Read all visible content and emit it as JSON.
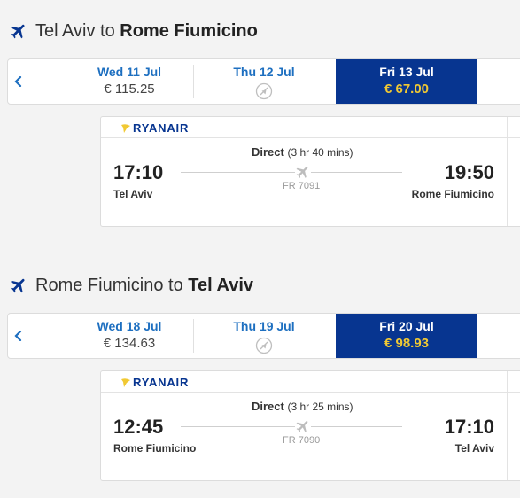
{
  "outbound": {
    "title_from": "Tel Aviv",
    "title_to_word": "to",
    "title_to": "Rome Fiumicino",
    "dates": [
      {
        "label": "Wed 11 Jul",
        "price": "€ 115.25",
        "selected": false,
        "available": true
      },
      {
        "label": "Thu 12 Jul",
        "price": "",
        "selected": false,
        "available": false
      },
      {
        "label": "Fri 13 Jul",
        "price": "€ 67.00",
        "selected": true,
        "available": true
      }
    ],
    "flight": {
      "airline": "RYANAIR",
      "type": "Direct",
      "duration": "(3 hr 40 mins)",
      "dep_time": "17:10",
      "arr_time": "19:50",
      "dep_city": "Tel Aviv",
      "arr_city": "Rome Fiumicino",
      "flight_number": "FR 7091"
    }
  },
  "inbound": {
    "title_from": "Rome Fiumicino",
    "title_to_word": "to",
    "title_to": "Tel Aviv",
    "dates": [
      {
        "label": "Wed 18 Jul",
        "price": "€ 134.63",
        "selected": false,
        "available": true
      },
      {
        "label": "Thu 19 Jul",
        "price": "",
        "selected": false,
        "available": false
      },
      {
        "label": "Fri 20 Jul",
        "price": "€ 98.93",
        "selected": true,
        "available": true
      }
    ],
    "flight": {
      "airline": "RYANAIR",
      "type": "Direct",
      "duration": "(3 hr 25 mins)",
      "dep_time": "12:45",
      "arr_time": "17:10",
      "dep_city": "Rome Fiumicino",
      "arr_city": "Tel Aviv",
      "flight_number": "FR 7090"
    }
  },
  "icons": {
    "leg_title": "plane-icon",
    "prev": "chevron-left-icon",
    "no_flight": "no-flight-icon",
    "route": "plane-icon",
    "logo": "harp-icon"
  },
  "colors": {
    "brand_blue": "#073590",
    "link_blue": "#1d6fc0",
    "selected_price": "#f1c933",
    "background": "#f3f3f3"
  }
}
